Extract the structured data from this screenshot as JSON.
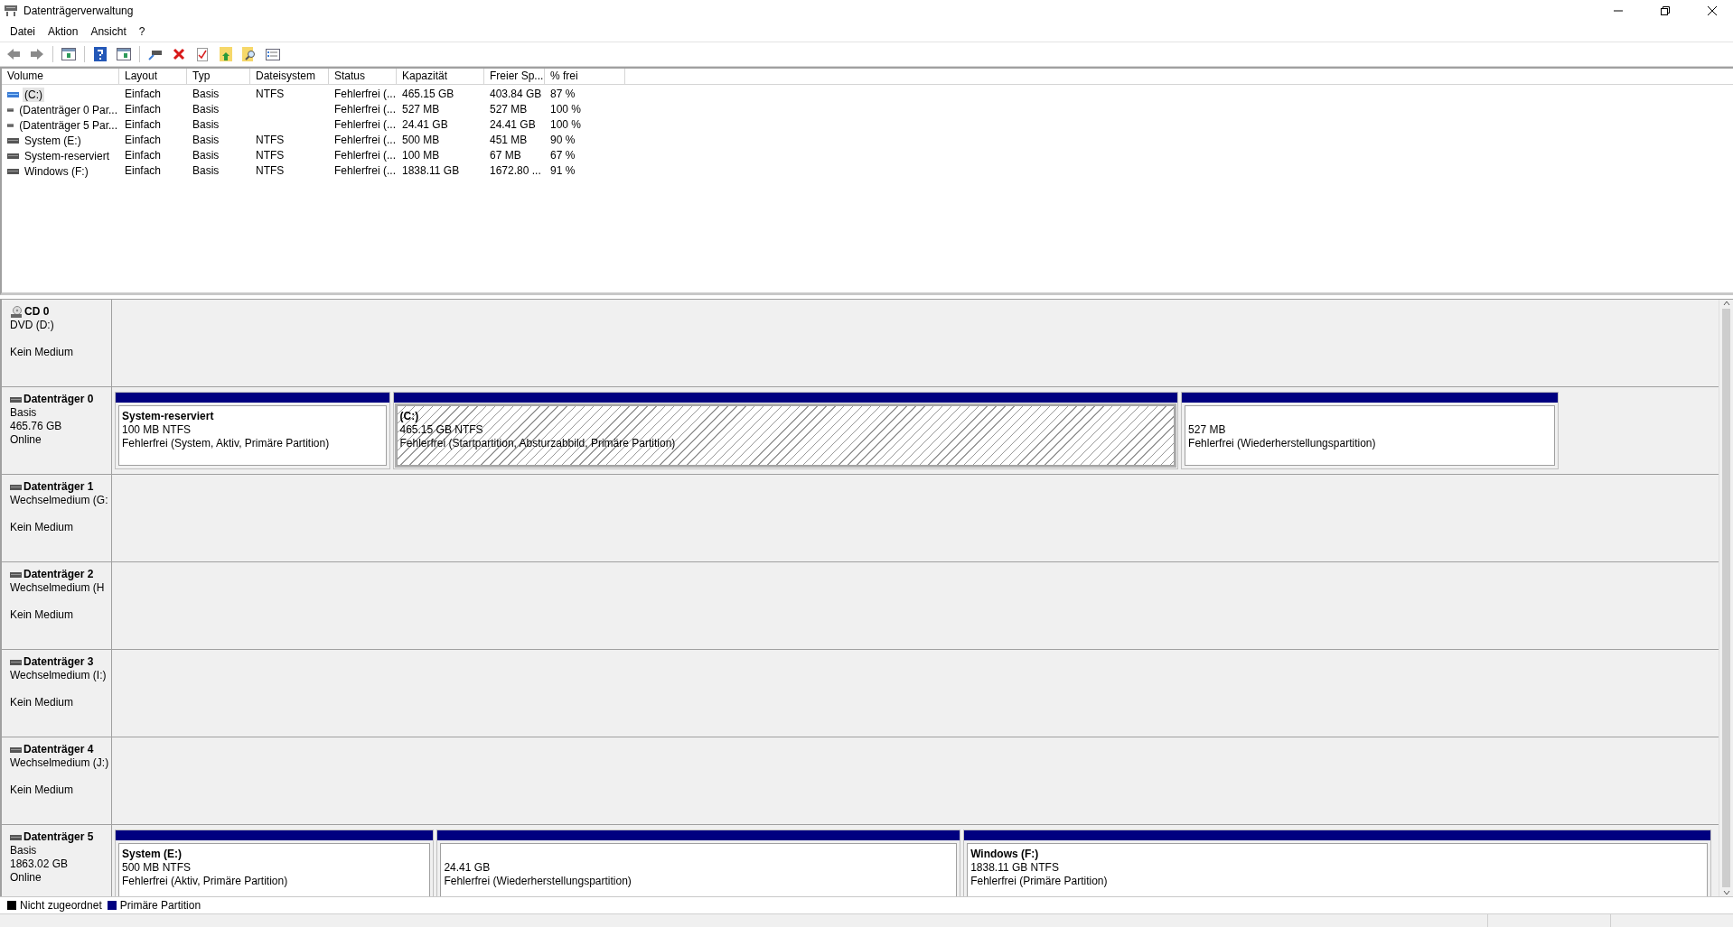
{
  "window": {
    "title": "Datenträgerverwaltung"
  },
  "menu": [
    "Datei",
    "Aktion",
    "Ansicht",
    "?"
  ],
  "table": {
    "columns": [
      "Volume",
      "Layout",
      "Typ",
      "Dateisystem",
      "Status",
      "Kapazität",
      "Freier Sp...",
      "% frei"
    ],
    "rows": [
      {
        "selected": true,
        "cells": [
          "(C:)",
          "Einfach",
          "Basis",
          "NTFS",
          "Fehlerfrei (...",
          "465.15 GB",
          "403.84 GB",
          "87 %"
        ]
      },
      {
        "selected": false,
        "cells": [
          "(Datenträger 0 Par...",
          "Einfach",
          "Basis",
          "",
          "Fehlerfrei (...",
          "527 MB",
          "527 MB",
          "100 %"
        ]
      },
      {
        "selected": false,
        "cells": [
          "(Datenträger 5 Par...",
          "Einfach",
          "Basis",
          "",
          "Fehlerfrei (...",
          "24.41 GB",
          "24.41 GB",
          "100 %"
        ]
      },
      {
        "selected": false,
        "cells": [
          "System (E:)",
          "Einfach",
          "Basis",
          "NTFS",
          "Fehlerfrei (...",
          "500 MB",
          "451 MB",
          "90 %"
        ]
      },
      {
        "selected": false,
        "cells": [
          "System-reserviert",
          "Einfach",
          "Basis",
          "NTFS",
          "Fehlerfrei (...",
          "100 MB",
          "67 MB",
          "67 %"
        ]
      },
      {
        "selected": false,
        "cells": [
          "Windows (F:)",
          "Einfach",
          "Basis",
          "NTFS",
          "Fehlerfrei (...",
          "1838.11 GB",
          "1672.80 ...",
          "91 %"
        ]
      }
    ]
  },
  "disks": [
    {
      "kind": "cd",
      "name": "CD 0",
      "type": "DVD (D:)",
      "status": "Kein Medium"
    },
    {
      "kind": "disk",
      "name": "Datenträger 0",
      "type": "Basis",
      "size": "465.76 GB",
      "status": "Online",
      "partitions": [
        {
          "selected": false,
          "label": "System-reserviert",
          "size": "100 MB NTFS",
          "status": "Fehlerfrei (System, Aktiv, Primäre Partition)"
        },
        {
          "selected": true,
          "label": "(C:)",
          "size": "465.15 GB NTFS",
          "status": "Fehlerfrei (Startpartition, Absturzabbild, Primäre Partition)"
        },
        {
          "selected": false,
          "size": "527 MB",
          "status": "Fehlerfrei (Wiederherstellungspartition)"
        }
      ]
    },
    {
      "kind": "disk",
      "name": "Datenträger 1",
      "type": "Wechselmedium (G:",
      "status": "Kein Medium"
    },
    {
      "kind": "disk",
      "name": "Datenträger 2",
      "type": "Wechselmedium (H",
      "status": "Kein Medium"
    },
    {
      "kind": "disk",
      "name": "Datenträger 3",
      "type": "Wechselmedium (I:)",
      "status": "Kein Medium"
    },
    {
      "kind": "disk",
      "name": "Datenträger 4",
      "type": "Wechselmedium (J:)",
      "status": "Kein Medium"
    },
    {
      "kind": "disk",
      "name": "Datenträger 5",
      "type": "Basis",
      "size": "1863.02 GB",
      "status": "Online",
      "partitions": [
        {
          "selected": false,
          "label": "System  (E:)",
          "size": "500 MB NTFS",
          "status": "Fehlerfrei (Aktiv, Primäre Partition)"
        },
        {
          "selected": false,
          "size": "24.41 GB",
          "status": "Fehlerfrei (Wiederherstellungspartition)"
        },
        {
          "selected": false,
          "label": "Windows  (F:)",
          "size": "1838.11 GB NTFS",
          "status": "Fehlerfrei (Primäre Partition)"
        }
      ]
    }
  ],
  "legend": [
    {
      "label": "Nicht zugeordnet",
      "color": "#000000"
    },
    {
      "label": "Primäre Partition",
      "color": "#000080"
    }
  ]
}
